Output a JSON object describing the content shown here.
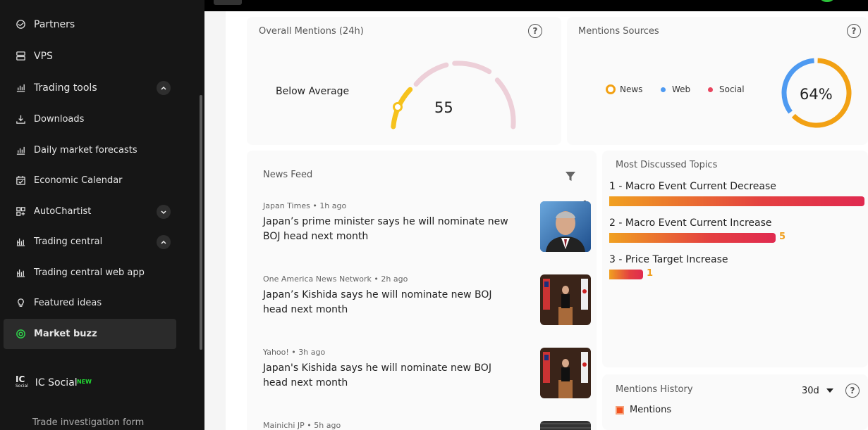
{
  "sidebar": {
    "items": [
      {
        "label": "Partners",
        "icon": "handshake-icon"
      },
      {
        "label": "VPS",
        "icon": "server-icon"
      },
      {
        "label": "Trading tools",
        "icon": "bar-chart-icon"
      },
      {
        "label": "Downloads",
        "icon": "download-icon"
      },
      {
        "label": "Daily market forecasts",
        "icon": "bar-chart-icon"
      },
      {
        "label": "Economic Calendar",
        "icon": "calendar-icon"
      },
      {
        "label": "AutoChartist",
        "icon": "grid-plus-icon"
      },
      {
        "label": "Trading central",
        "icon": "chart-icon"
      },
      {
        "label": "Trading central web app",
        "icon": "chart-icon"
      },
      {
        "label": "Featured ideas",
        "icon": "lightbulb-icon"
      },
      {
        "label": "Market buzz",
        "icon": "market-buzz-icon"
      }
    ],
    "ic_social": {
      "logo_main": "IC",
      "logo_sub": "Social",
      "label": "IC Social",
      "badge": "NEW"
    },
    "cutoff_label": "Trade investigation form"
  },
  "overall_mentions": {
    "title": "Overall Mentions (24h)",
    "status": "Below Average",
    "value": "55",
    "gauge_fraction": 0.12
  },
  "mentions_sources": {
    "title": "Mentions Sources",
    "legend": [
      {
        "label": "News",
        "color": "#f2a114"
      },
      {
        "label": "Web",
        "color": "#4e9af1"
      },
      {
        "label": "Social",
        "color": "#e8455e"
      }
    ],
    "percent_label": "64%",
    "fractions": {
      "news": 0.64,
      "web": 0.36
    }
  },
  "news_feed": {
    "title": "News Feed",
    "items": [
      {
        "source": "Japan Times",
        "time": "1h ago",
        "title": "Japan’s prime minister says he will nominate new BOJ head next month"
      },
      {
        "source": "One America News Network",
        "time": "2h ago",
        "title": "Japan’s Kishida says he will nominate new BOJ head next month"
      },
      {
        "source": "Yahoo!",
        "time": "3h ago",
        "title": "Japan's Kishida says he will nominate new BOJ head next month"
      },
      {
        "source": "Mainichi JP",
        "time": "5h ago",
        "title": ""
      }
    ]
  },
  "most_discussed": {
    "title": "Most Discussed Topics",
    "topics": [
      {
        "label": "1 - Macro Event Current Decrease",
        "count": ""
      },
      {
        "label": "2 - Macro Event Current Increase",
        "count": "5"
      },
      {
        "label": "3 - Price Target Increase",
        "count": "1"
      }
    ]
  },
  "mentions_history": {
    "title": "Mentions History",
    "range": "30d",
    "legend_label": "Mentions",
    "legend_color": "#f2521f"
  },
  "colors": {
    "accent": "#f2a114",
    "sidebar_bg": "#161616",
    "active_item": "#2b2b2b"
  }
}
